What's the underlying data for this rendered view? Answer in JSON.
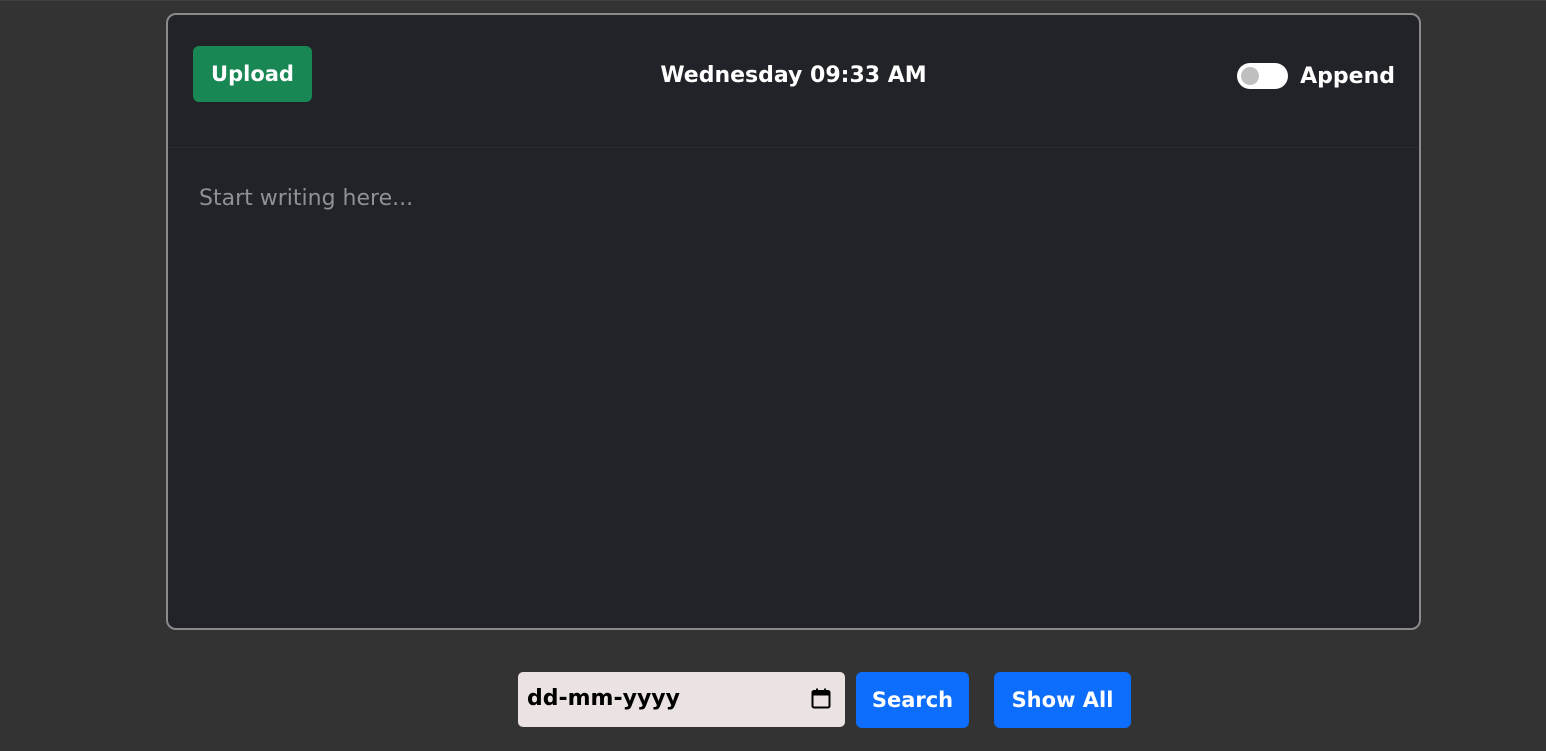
{
  "header": {
    "upload_label": "Upload",
    "datetime": "Wednesday 09:33 AM",
    "append_label": "Append",
    "append_enabled": false
  },
  "editor": {
    "placeholder": "Start writing here...",
    "value": ""
  },
  "search": {
    "date_placeholder": "dd-mm-yyyy",
    "search_label": "Search",
    "show_all_label": "Show All"
  },
  "icons": {
    "calendar": "calendar-icon"
  },
  "colors": {
    "background": "#333333",
    "card": "#212328",
    "upload_button": "#198754",
    "primary_button": "#0d6efd",
    "date_field": "#ebe3e1"
  }
}
